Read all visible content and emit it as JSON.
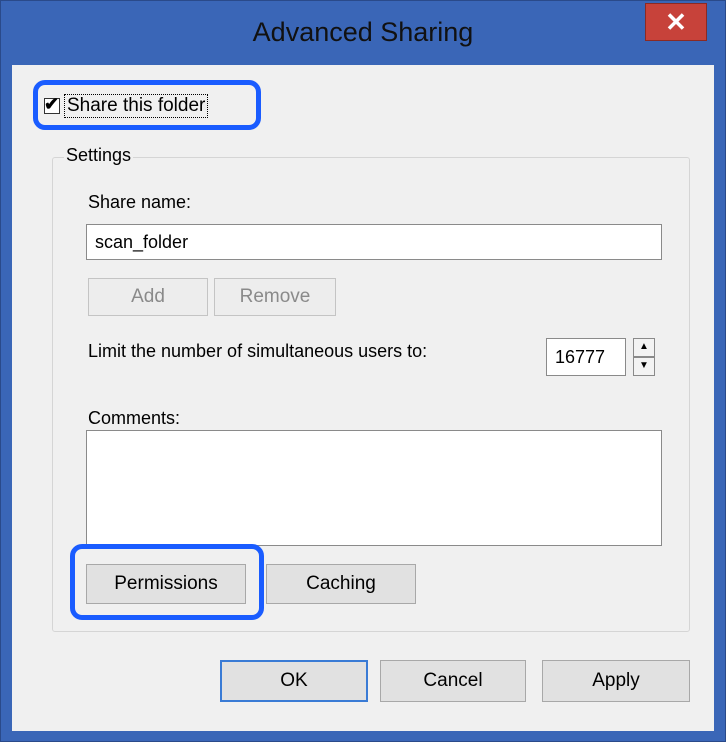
{
  "window": {
    "title": "Advanced Sharing",
    "close_glyph": "✕"
  },
  "share_checkbox": {
    "label": "Share this folder",
    "checked": true,
    "check_glyph": "✔"
  },
  "settings": {
    "group_label": "Settings",
    "share_name_label": "Share name:",
    "share_name_value": "scan_folder",
    "add_label": "Add",
    "remove_label": "Remove",
    "limit_label": "Limit the number of simultaneous users to:",
    "limit_value": "16777",
    "spin_up_glyph": "▲",
    "spin_down_glyph": "▼",
    "comments_label": "Comments:",
    "comments_value": "",
    "permissions_label": "Permissions",
    "caching_label": "Caching"
  },
  "footer": {
    "ok_label": "OK",
    "cancel_label": "Cancel",
    "apply_label": "Apply"
  },
  "colors": {
    "highlight": "#1a5cff",
    "title_bar": "#3a66b7",
    "close": "#c7423a",
    "client": "#f0f0f0"
  }
}
